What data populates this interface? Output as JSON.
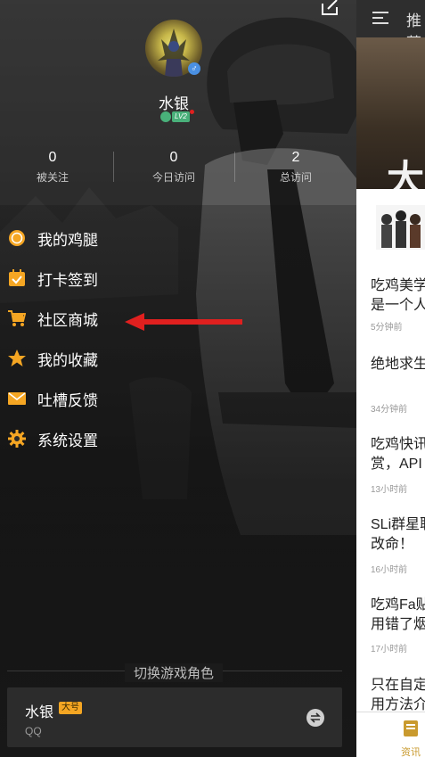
{
  "profile": {
    "username": "水银",
    "level_badge": "LV2",
    "gender_icon": "male-icon"
  },
  "stats": [
    {
      "value": "0",
      "label": "被关注"
    },
    {
      "value": "0",
      "label": "今日访问"
    },
    {
      "value": "2",
      "label": "总访问"
    }
  ],
  "menu": [
    {
      "label": "我的鸡腿",
      "icon": "coin-icon"
    },
    {
      "label": "打卡签到",
      "icon": "calendar-check-icon"
    },
    {
      "label": "社区商城",
      "icon": "cart-icon"
    },
    {
      "label": "我的收藏",
      "icon": "star-icon"
    },
    {
      "label": "吐槽反馈",
      "icon": "envelope-icon"
    },
    {
      "label": "系统设置",
      "icon": "gear-icon"
    }
  ],
  "switch_role": {
    "title": "切换游戏角色",
    "name": "水银",
    "tag": "大号",
    "platform": "QQ"
  },
  "right_panel": {
    "tab_partial": "推荐",
    "banner_text": "大",
    "items": [
      {
        "title": "吃鸡美学",
        "title2": "是一个人",
        "meta": "5分钟前"
      },
      {
        "title": "绝地求生",
        "title2": "",
        "meta": "34分钟前"
      },
      {
        "title": "吃鸡快讯",
        "title2": "赏，API",
        "meta": "13小时前"
      },
      {
        "title": "SLi群星联",
        "title2": "改命！",
        "meta": "16小时前"
      },
      {
        "title": "吃鸡Fa贴",
        "title2": "用错了烟",
        "meta": "17小时前"
      },
      {
        "title": "只在自定",
        "title2": "用方法介",
        "meta": ""
      }
    ],
    "bottom_tab": "资讯"
  },
  "colors": {
    "accent_orange": "#f5a623",
    "arrow_red": "#e0201f",
    "level_green": "#49b07a",
    "gender_blue": "#4a90e2"
  }
}
